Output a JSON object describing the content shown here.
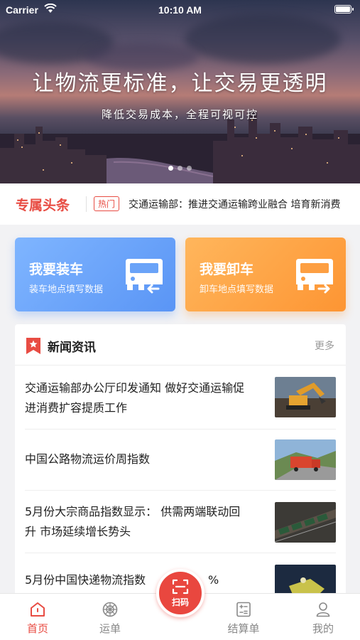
{
  "status_bar": {
    "carrier": "Carrier",
    "time": "10:10 AM"
  },
  "banner": {
    "slogan": "让物流更标准，让交易更透明",
    "subtitle": "降低交易成本，全程可视可控",
    "dots_total": 3,
    "dots_active": 1
  },
  "headline": {
    "title": "专属头条",
    "tag": "热门",
    "text": "交通运输部：推进交通运输跨业融合 培育新消费"
  },
  "actions": [
    {
      "title": "我要装车",
      "subtitle": "装车地点填写数据",
      "icon": "truck-load-icon"
    },
    {
      "title": "我要卸车",
      "subtitle": "卸车地点填写数据",
      "icon": "truck-unload-icon"
    }
  ],
  "news": {
    "title": "新闻资讯",
    "more": "更多",
    "items": [
      {
        "line1": "交通运输部办公厅印发通知 做好交通运输促",
        "line2": "进消费扩容提质工作",
        "thumb": "excavator-photo"
      },
      {
        "line1": "中国公路物流运价周指数",
        "line2": "",
        "thumb": "truck-road-photo"
      },
      {
        "line1": "5月份大宗商品指数显示： 供需两端联动回",
        "line2": "升 市场延续增长势头",
        "thumb": "train-photo"
      },
      {
        "line1": "5月份中国快递物流指数",
        "line2": "",
        "thumb": "night-machine-photo",
        "tail": "%"
      }
    ]
  },
  "tabbar": {
    "tabs": [
      {
        "label": "首页",
        "icon": "home-icon",
        "active": true
      },
      {
        "label": "运单",
        "icon": "waybill-icon",
        "active": false
      },
      {
        "label": "结算单",
        "icon": "settlement-icon",
        "active": false
      },
      {
        "label": "我的",
        "icon": "profile-icon",
        "active": false
      }
    ],
    "scan_label": "扫码"
  },
  "colors": {
    "accent": "#e84c43",
    "load_card": "#6aa3f8",
    "unload_card": "#fd9f42"
  }
}
